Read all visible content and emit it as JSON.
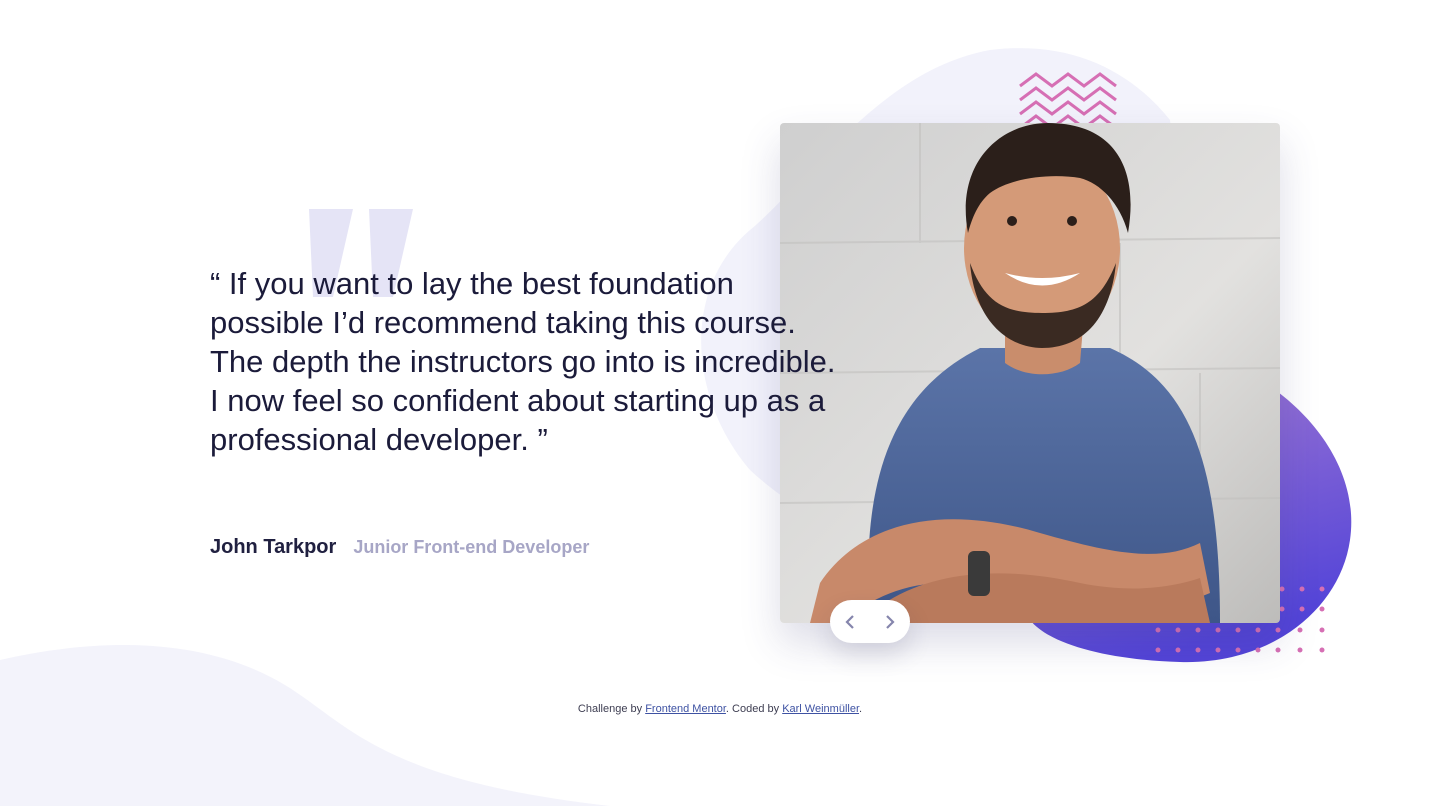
{
  "testimonial": {
    "quote": "“ If you want to lay the best foundation possible I’d recommend taking this course. The depth the instructors go into is incredible. I now feel so confident about starting up as a professional developer. ”",
    "author_name": "John Tarkpor",
    "author_role": "Junior Front-end Developer"
  },
  "navigation": {
    "prev_icon": "chevron-left-icon",
    "next_icon": "chevron-right-icon"
  },
  "footer": {
    "prefix": "Challenge by ",
    "link1": "Frontend Mentor",
    "middle": ". Coded by ",
    "link2": "Karl Weinmüller",
    "suffix": "."
  },
  "colors": {
    "quote_text": "#1b1b3a",
    "author_name": "#202040",
    "author_role": "#a7a6c6",
    "accent_purple": "#6e4fd8",
    "accent_pink": "#d66fb4",
    "background_tint": "#f2f2fb"
  }
}
